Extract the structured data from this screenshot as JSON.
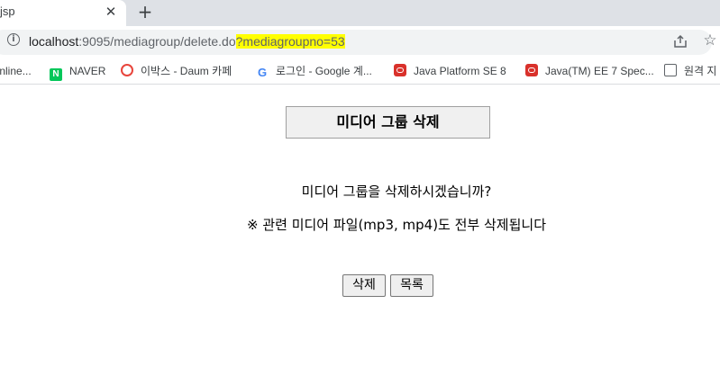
{
  "browser": {
    "tab_title": "jsp",
    "tab_close_glyph": "✕",
    "new_tab_glyph": "+",
    "url_host": "localhost",
    "url_path": ":9095/mediagroup/delete.do",
    "url_query": "?mediagroupno=53",
    "highlight_color": "#ffff00"
  },
  "bookmarks": [
    {
      "label": "Online...",
      "icon": "none"
    },
    {
      "label": "NAVER",
      "icon": "naver-icon"
    },
    {
      "label": "이박스 - Daum 카페",
      "icon": "daum-icon"
    },
    {
      "label": "로그인 - Google 계...",
      "icon": "google-icon"
    },
    {
      "label": "Java Platform SE 8",
      "icon": "oracle-icon"
    },
    {
      "label": "Java(TM) EE 7 Spec...",
      "icon": "oracle-icon"
    },
    {
      "label": "원격 지",
      "icon": "remote-icon"
    }
  ],
  "page": {
    "title": "미디어 그룹 삭제",
    "confirm_message": "미디어 그룹을 삭제하시겠습니까?",
    "warning_message": "※ 관련 미디어 파일(mp3, mp4)도 전부 삭제됩니다",
    "delete_button": "삭제",
    "list_button": "목록"
  }
}
